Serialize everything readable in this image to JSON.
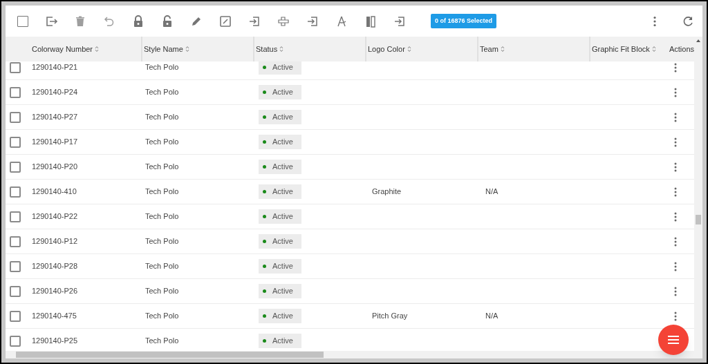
{
  "toolbar": {
    "select_all_checked": false,
    "selection_badge": "0 of 16876 Selected"
  },
  "table": {
    "columns": [
      {
        "label": "Colorway Number",
        "sortable": true
      },
      {
        "label": "Style Name",
        "sortable": true
      },
      {
        "label": "Status",
        "sortable": true
      },
      {
        "label": "Logo Color",
        "sortable": true
      },
      {
        "label": "Team",
        "sortable": true
      },
      {
        "label": "Graphic Fit Block",
        "sortable": true
      },
      {
        "label": "Actions",
        "sortable": false
      }
    ],
    "rows": [
      {
        "checked": false,
        "cells": [
          "1290140-P21",
          "Tech Polo",
          "Active",
          "",
          ""
        ],
        "actions_menu": true
      },
      {
        "checked": false,
        "cells": [
          "1290140-P24",
          "Tech Polo",
          "Active",
          "",
          ""
        ],
        "actions_menu": true
      },
      {
        "checked": false,
        "cells": [
          "1290140-P27",
          "Tech Polo",
          "Active",
          "",
          ""
        ],
        "actions_menu": true
      },
      {
        "checked": false,
        "cells": [
          "1290140-P17",
          "Tech Polo",
          "Active",
          "",
          ""
        ],
        "actions_menu": true
      },
      {
        "checked": false,
        "cells": [
          "1290140-P20",
          "Tech Polo",
          "Active",
          "",
          ""
        ],
        "actions_menu": true
      },
      {
        "checked": false,
        "cells": [
          "1290140-410",
          "Tech Polo",
          "Active",
          "Graphite",
          "N/A"
        ],
        "actions_menu": true
      },
      {
        "checked": false,
        "cells": [
          "1290140-P22",
          "Tech Polo",
          "Active",
          "",
          ""
        ],
        "actions_menu": true
      },
      {
        "checked": false,
        "cells": [
          "1290140-P12",
          "Tech Polo",
          "Active",
          "",
          ""
        ],
        "actions_menu": true
      },
      {
        "checked": false,
        "cells": [
          "1290140-P28",
          "Tech Polo",
          "Active",
          "",
          ""
        ],
        "actions_menu": true
      },
      {
        "checked": false,
        "cells": [
          "1290140-P26",
          "Tech Polo",
          "Active",
          "",
          ""
        ],
        "actions_menu": true
      },
      {
        "checked": false,
        "cells": [
          "1290140-475",
          "Tech Polo",
          "Active",
          "Pitch Gray",
          "N/A"
        ],
        "actions_menu": true
      },
      {
        "checked": false,
        "cells": [
          "1290140-P25",
          "Tech Polo",
          "Active",
          "",
          ""
        ],
        "actions_menu": false
      }
    ]
  }
}
